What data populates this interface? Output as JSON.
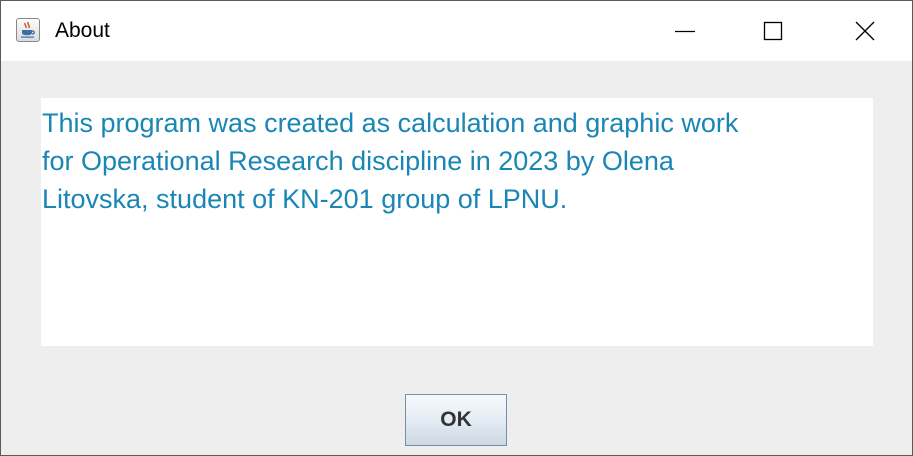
{
  "window": {
    "title": "About",
    "app_icon": "java-coffee-cup-icon",
    "controls": [
      "minimize-icon",
      "maximize-icon",
      "close-icon"
    ]
  },
  "content": {
    "message": "This program was created as calculation and graphic work\nfor Operational Research discipline in 2023 by Olena\nLitovska, student of KN-201 group of LPNU.",
    "text_color": "#1a86b6"
  },
  "buttons": {
    "ok_label": "OK"
  }
}
